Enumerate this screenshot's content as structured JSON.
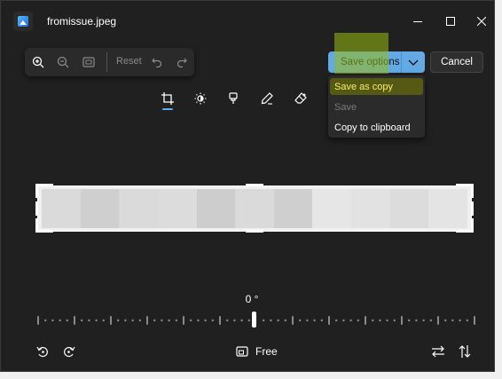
{
  "window": {
    "title": "fromissue.jpeg"
  },
  "zoom_toolbar": {
    "reset_label": "Reset"
  },
  "actions": {
    "save_options_label": "Save options",
    "cancel_label": "Cancel"
  },
  "save_menu": {
    "items": [
      "Save as copy",
      "Save",
      "Copy to clipboard"
    ]
  },
  "rotation": {
    "angle_text": "0 °"
  },
  "aspect_ratio": {
    "label": "Free"
  },
  "colors": {
    "accent": "#63a9e4",
    "background": "#202020",
    "highlight": "#9abe10"
  },
  "image_strip_colors": [
    "#dadada",
    "#cfcfcf",
    "#dadada",
    "#dcdcdc",
    "#cdcdcd",
    "#dadada",
    "#cfcfcf",
    "#e6e6e6",
    "#e2e2e2",
    "#dcdcdc",
    "#e4e4e4"
  ],
  "icons": [
    "photos-app-icon",
    "zoom-in-icon",
    "zoom-out-icon",
    "fit-to-window-icon",
    "undo-icon",
    "redo-icon",
    "crop-icon",
    "brightness-icon",
    "markup-brush-icon",
    "draw-pen-icon",
    "erase-icon",
    "rotate-left-icon",
    "rotate-right-icon",
    "aspect-ratio-icon",
    "flip-horizontal-icon",
    "flip-vertical-icon"
  ]
}
